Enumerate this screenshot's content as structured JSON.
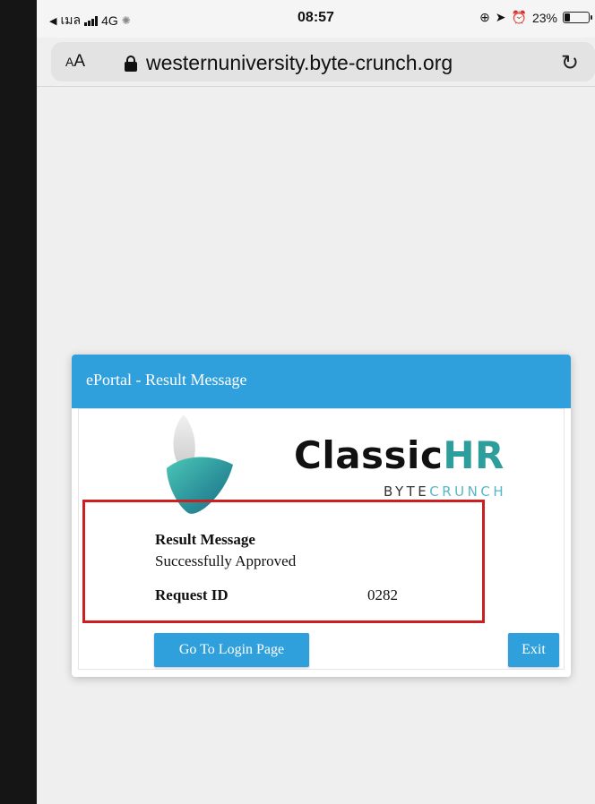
{
  "status_bar": {
    "carrier": "เมล",
    "network": "4G",
    "time": "08:57",
    "battery": "23%",
    "battery_level": 0.23
  },
  "browser": {
    "text_size_label": "AA",
    "url": "westernuniversity.byte-crunch.org",
    "reload_icon": "reload-icon"
  },
  "dialog": {
    "title": "ePortal - Result Message",
    "logo": {
      "name_part1": "Classic",
      "name_part2": "HR",
      "sub_part1": "BYTE",
      "sub_part2": "CRUNCH"
    },
    "result_label": "Result Message",
    "result_value": "Successfully Approved",
    "request_label": "Request ID",
    "request_value": "0282",
    "login_button": "Go To Login Page",
    "exit_button": "Exit"
  },
  "colors": {
    "header_blue": "#2fa0dc",
    "button_blue": "#2fa0dc",
    "logo_teal": "#2d9e9c",
    "highlight_red": "#cc1f1f"
  }
}
